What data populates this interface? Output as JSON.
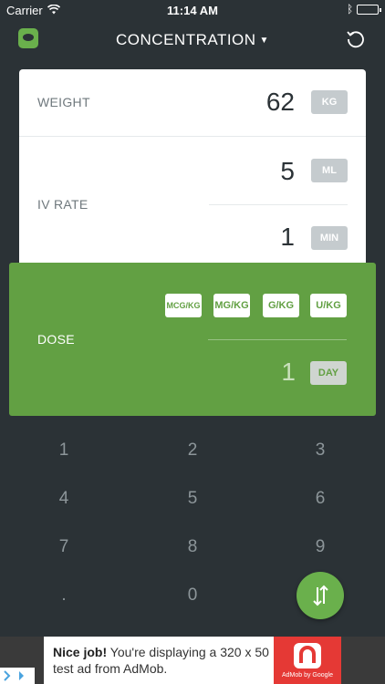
{
  "status": {
    "carrier": "Carrier",
    "time": "11:14 AM"
  },
  "header": {
    "title": "CONCENTRATION",
    "logo_icon": "logo-icon",
    "reset_icon": "reset-icon"
  },
  "weight": {
    "label": "WEIGHT",
    "value": "62",
    "unit": "KG"
  },
  "iv_rate": {
    "label": "IV RATE",
    "volume": "5",
    "volume_unit": "ML",
    "time": "1",
    "time_unit": "MIN"
  },
  "dose": {
    "label": "DOSE",
    "units": [
      "MCG/KG",
      "MG/KG",
      "G/KG",
      "U/KG"
    ],
    "value": "1",
    "time_unit": "DAY"
  },
  "keypad": {
    "keys": [
      "1",
      "2",
      "3",
      "4",
      "5",
      "6",
      "7",
      "8",
      "9",
      ".",
      "0"
    ]
  },
  "ad": {
    "headline": "Nice job!",
    "body": "You're displaying a 320 x 50 test ad from AdMob.",
    "brand": "AdMob by Google"
  },
  "colors": {
    "background": "#2b3236",
    "accent": "#62a043",
    "unit_chip": "#c5cbce"
  }
}
